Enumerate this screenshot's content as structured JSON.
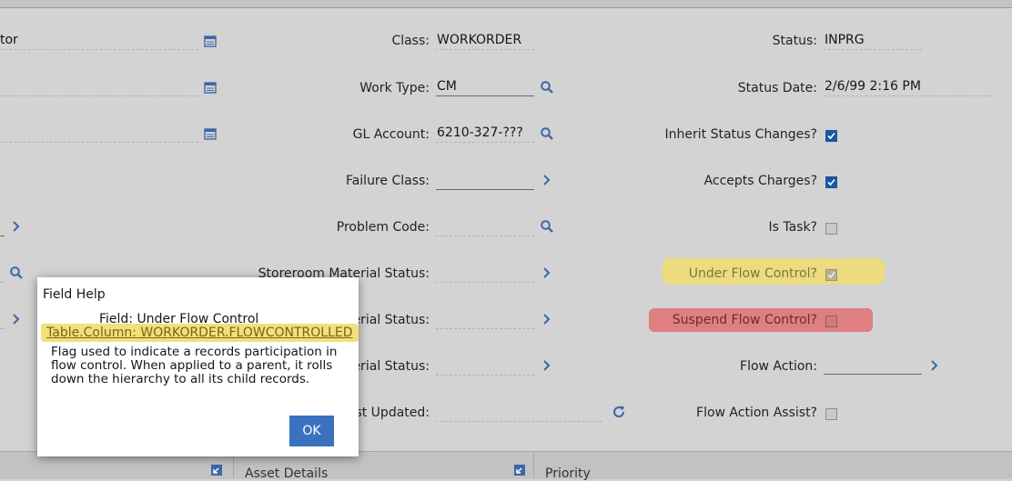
{
  "left_column": {
    "value_row1": "tor"
  },
  "middle_column": {
    "class": {
      "label": "Class:",
      "value": "WORKORDER"
    },
    "work_type": {
      "label": "Work Type:",
      "value": "CM"
    },
    "gl_account": {
      "label": "GL Account:",
      "value": "6210-327-???"
    },
    "failure_class": {
      "label": "Failure Class:",
      "value": ""
    },
    "problem_code": {
      "label": "Problem Code:",
      "value": ""
    },
    "storeroom_status": {
      "label": "Storeroom Material Status:",
      "value": ""
    },
    "material_status_2": {
      "label": "erial Status:",
      "value": ""
    },
    "material_status_3": {
      "label": "erial Status:",
      "value": ""
    },
    "last_updated": {
      "label": "st Updated:",
      "value": ""
    }
  },
  "right_column": {
    "status": {
      "label": "Status:",
      "value": "INPRG"
    },
    "status_date": {
      "label": "Status Date:",
      "value": "2/6/99 2:16 PM"
    },
    "inherit_status": {
      "label": "Inherit Status Changes?",
      "checked": true
    },
    "accepts_charges": {
      "label": "Accepts Charges?",
      "checked": true
    },
    "is_task": {
      "label": "Is Task?",
      "checked": false
    },
    "under_flow_control": {
      "label": "Under Flow Control?",
      "checked": true,
      "disabled": true
    },
    "suspend_flow_control": {
      "label": "Suspend Flow Control?",
      "checked": false
    },
    "flow_action": {
      "label": "Flow Action:",
      "value": ""
    },
    "flow_action_assist": {
      "label": "Flow Action Assist?",
      "checked": false
    }
  },
  "bottom_bar": {
    "asset_details": "Asset Details",
    "priority": "Priority"
  },
  "field_help_dialog": {
    "title": "Field Help",
    "field_line": "Field: Under Flow Control",
    "table_column": "Table.Column: WORKORDER.FLOWCONTROLLED",
    "description": "Flag used to indicate a records participation in flow control. When applied to a parent, it rolls down the hierarchy to all its child records.",
    "ok_label": "OK"
  },
  "colors": {
    "checkbox_checked": "#1b56a3",
    "highlight_yellow": "#eddc7a",
    "highlight_red": "#df7a7d",
    "ok_button": "#3a72bf"
  },
  "icons": [
    "calendar-icon",
    "search-icon",
    "chevron-right-icon",
    "refresh-icon"
  ]
}
